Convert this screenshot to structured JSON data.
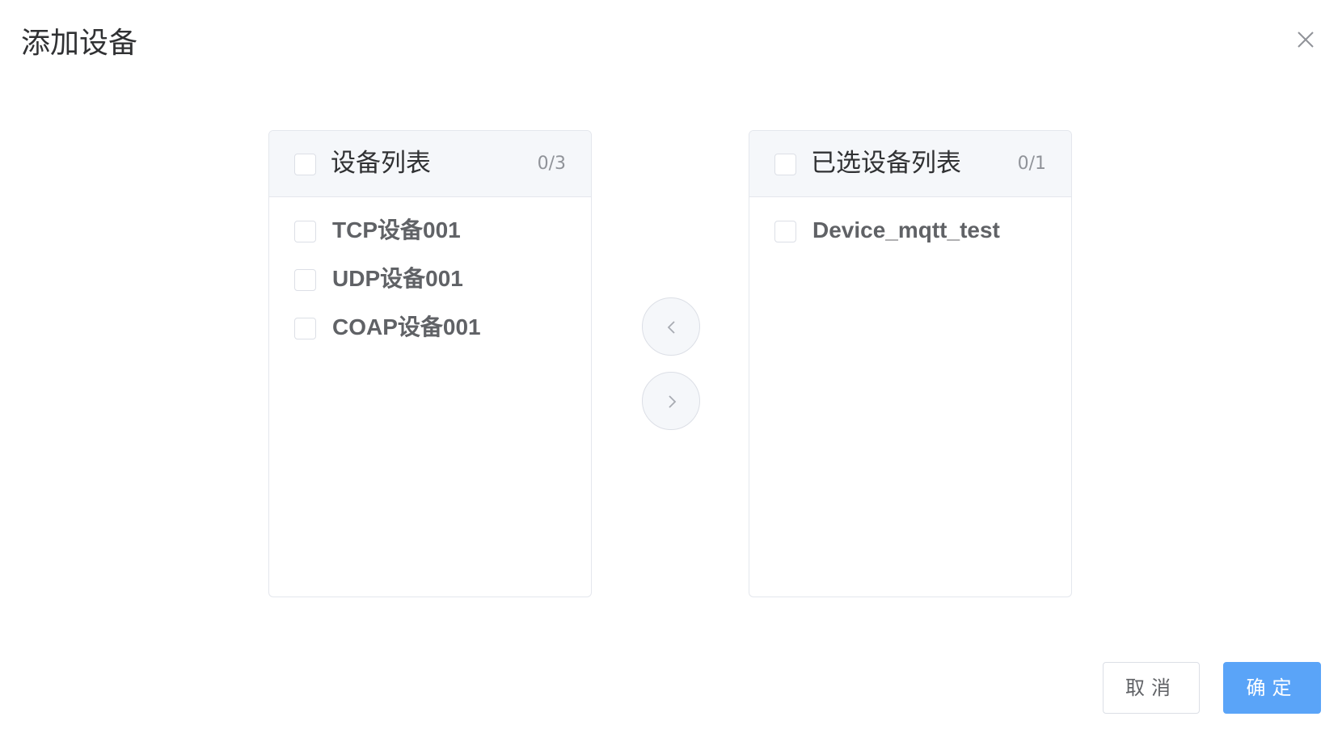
{
  "dialog": {
    "title": "添加设备",
    "close_icon": "close-icon"
  },
  "source_panel": {
    "title": "设备列表",
    "count": "0/3",
    "items": [
      {
        "label": "TCP设备001",
        "checked": false
      },
      {
        "label": "UDP设备001",
        "checked": false
      },
      {
        "label": "COAP设备001",
        "checked": false
      }
    ]
  },
  "target_panel": {
    "title": "已选设备列表",
    "count": "0/1",
    "items": [
      {
        "label": "Device_mqtt_test",
        "checked": false
      }
    ]
  },
  "transfer": {
    "to_left_icon": "chevron-left-icon",
    "to_right_icon": "chevron-right-icon"
  },
  "footer": {
    "cancel_label": "取消",
    "confirm_label": "确定"
  },
  "colors": {
    "primary": "#5aa4f8",
    "border": "#dcdfe6",
    "header_bg": "#f5f7fa",
    "text_primary": "#303133",
    "text_regular": "#606266",
    "text_secondary": "#909399"
  }
}
